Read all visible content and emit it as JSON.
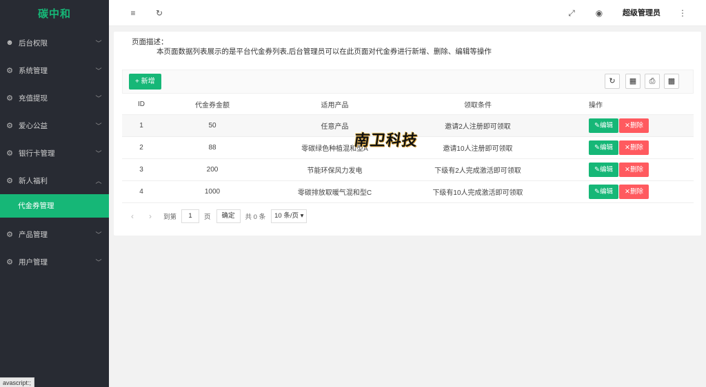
{
  "app": {
    "logo": "碳中和"
  },
  "sidebar": {
    "items": [
      {
        "label": "后台权限",
        "icon": "user-icon",
        "chevron": "﹀"
      },
      {
        "label": "系统管理",
        "icon": "gear-icon",
        "chevron": "﹀"
      },
      {
        "label": "充值提现",
        "icon": "gear-icon",
        "chevron": "﹀"
      },
      {
        "label": "爱心公益",
        "icon": "gear-icon",
        "chevron": "﹀"
      },
      {
        "label": "银行卡管理",
        "icon": "gear-icon",
        "chevron": "﹀"
      },
      {
        "label": "新人福利",
        "icon": "gear-icon",
        "chevron": "︿"
      },
      {
        "label": "产品管理",
        "icon": "gear-icon",
        "chevron": "﹀"
      },
      {
        "label": "用户管理",
        "icon": "gear-icon",
        "chevron": "﹀"
      }
    ],
    "active_sub": "代金券管理"
  },
  "statusbar": {
    "text": "avascript:;"
  },
  "header": {
    "admin_name": "超级管理员"
  },
  "page": {
    "desc_title": "页面描述：",
    "desc_text": "本页面数据列表展示的是平台代金券列表,后台管理员可以在此页面对代金券进行新增、删除、编辑等操作"
  },
  "toolbar": {
    "add_label": "+ 新增"
  },
  "table": {
    "headers": [
      "ID",
      "代金券金额",
      "适用产品",
      "领取条件",
      "操作"
    ],
    "rows": [
      {
        "id": "1",
        "amount": "50",
        "product": "任意产品",
        "condition": "邀请2人注册即可领取"
      },
      {
        "id": "2",
        "amount": "88",
        "product": "零碳绿色种植混和型A",
        "condition": "邀请10人注册即可领取"
      },
      {
        "id": "3",
        "amount": "200",
        "product": "节能环保风力发电",
        "condition": "下级有2人完成激活即可领取"
      },
      {
        "id": "4",
        "amount": "1000",
        "product": "零碳排放取暖气混和型C",
        "condition": "下级有10人完成激活即可领取"
      }
    ],
    "edit_label": "编辑",
    "delete_label": "删除"
  },
  "pager": {
    "goto_label": "到第",
    "page_value": "1",
    "page_unit": "页",
    "confirm_label": "确定",
    "total_label": "共 0 条",
    "page_size": "10 条/页"
  },
  "watermark": {
    "text": "南卫科技"
  }
}
